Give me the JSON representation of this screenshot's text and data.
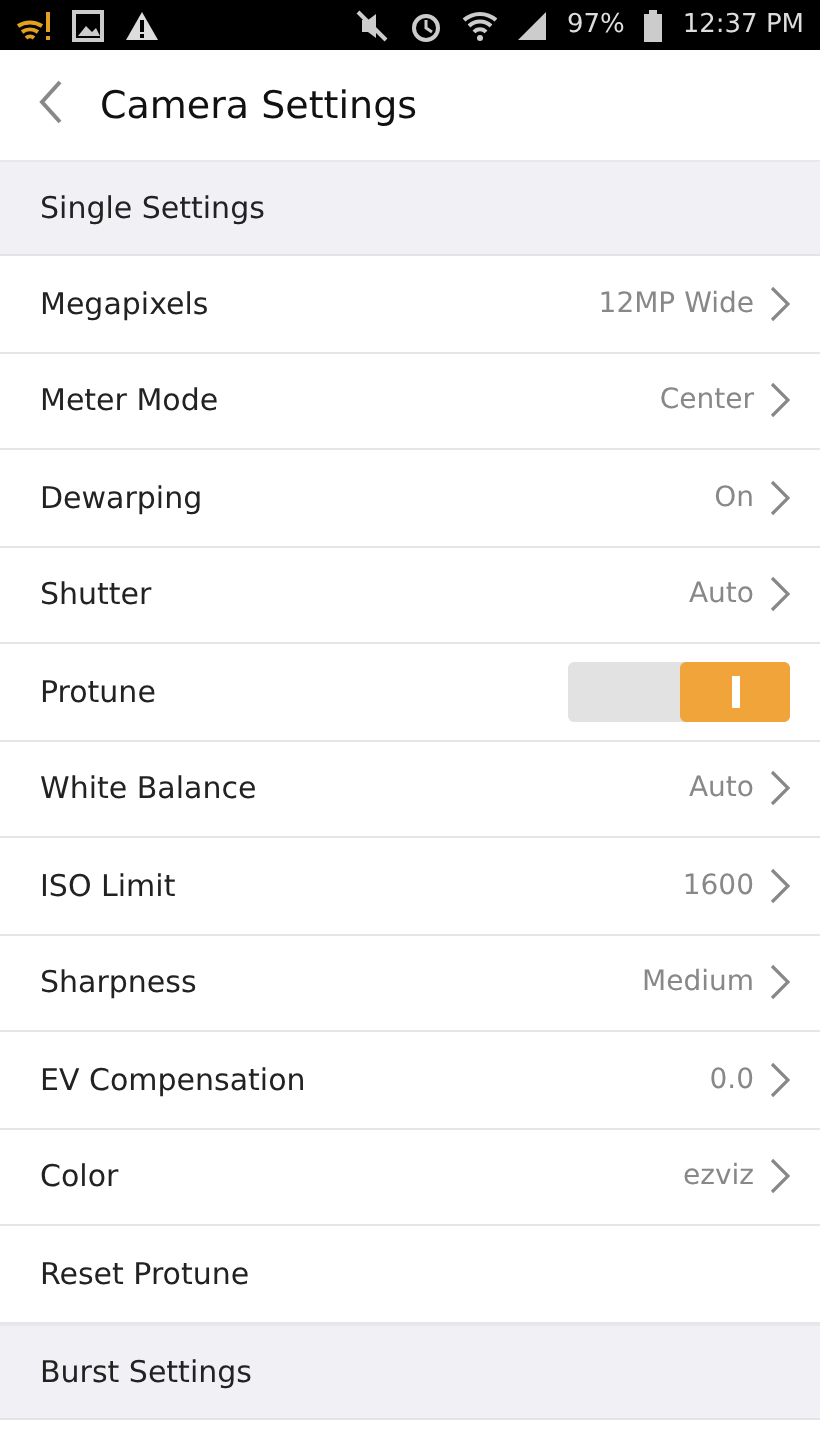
{
  "status_bar": {
    "battery": "97%",
    "time": "12:37 PM"
  },
  "header": {
    "title": "Camera Settings"
  },
  "sections": [
    {
      "title": "Single Settings",
      "items": [
        {
          "kind": "value",
          "label": "Megapixels",
          "value": "12MP Wide"
        },
        {
          "kind": "value",
          "label": "Meter Mode",
          "value": "Center"
        },
        {
          "kind": "value",
          "label": "Dewarping",
          "value": "On"
        },
        {
          "kind": "value",
          "label": "Shutter",
          "value": "Auto"
        },
        {
          "kind": "toggle",
          "label": "Protune",
          "on": true
        },
        {
          "kind": "value",
          "label": "White Balance",
          "value": "Auto"
        },
        {
          "kind": "value",
          "label": "ISO Limit",
          "value": "1600"
        },
        {
          "kind": "value",
          "label": "Sharpness",
          "value": "Medium"
        },
        {
          "kind": "value",
          "label": "EV Compensation",
          "value": "0.0"
        },
        {
          "kind": "value",
          "label": "Color",
          "value": "ezviz"
        },
        {
          "kind": "action",
          "label": "Reset Protune"
        }
      ]
    },
    {
      "title": "Burst Settings"
    }
  ]
}
